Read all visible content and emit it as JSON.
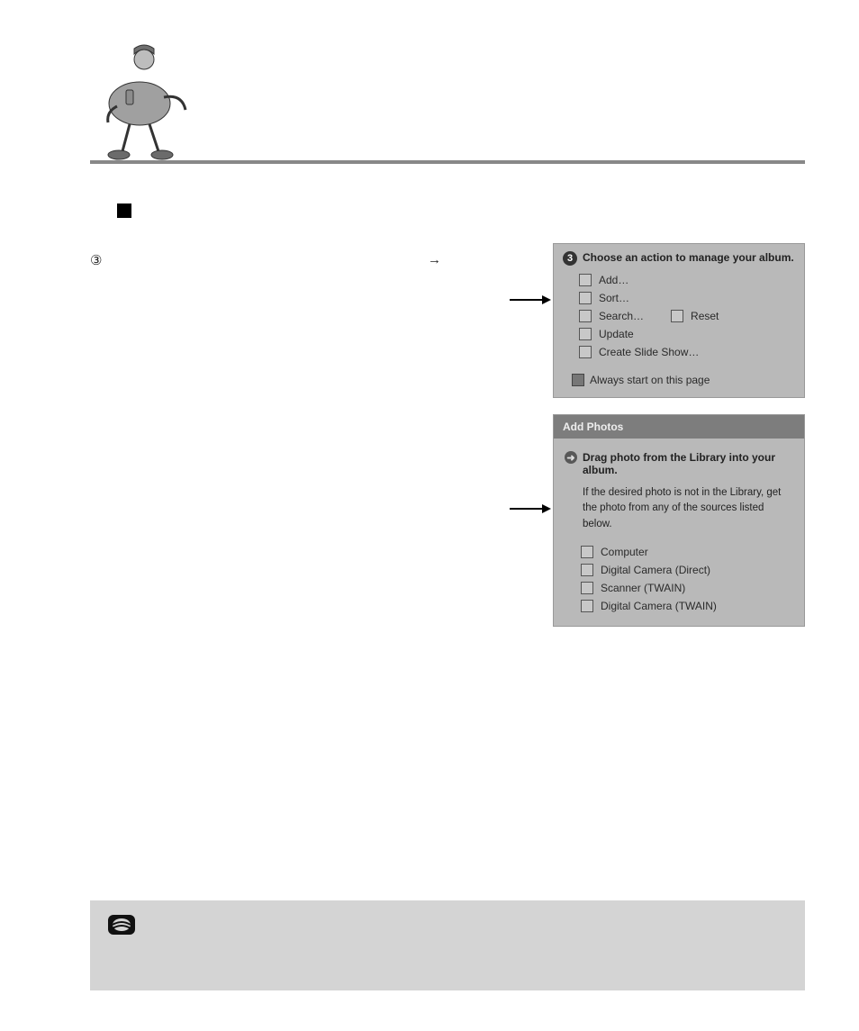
{
  "header": {
    "mascot_alt": "delivery-mascot"
  },
  "step": {
    "circled": "③",
    "arrow": "→"
  },
  "panelA": {
    "step_num": "3",
    "step_text": "Choose an action to manage your album.",
    "add": "Add…",
    "sort": "Sort…",
    "search": "Search…",
    "reset": "Reset",
    "update": "Update",
    "slideshow": "Create Slide Show…",
    "always": "Always start on this page"
  },
  "panelB": {
    "title": "Add Photos",
    "lead": "Drag photo from the Library into your album.",
    "sub": "If the desired photo is not in the Library, get the photo from any of the sources listed below.",
    "computer": "Computer",
    "dc_direct": "Digital Camera (Direct)",
    "scanner": "Scanner (TWAIN)",
    "dc_twain": "Digital Camera (TWAIN)"
  }
}
